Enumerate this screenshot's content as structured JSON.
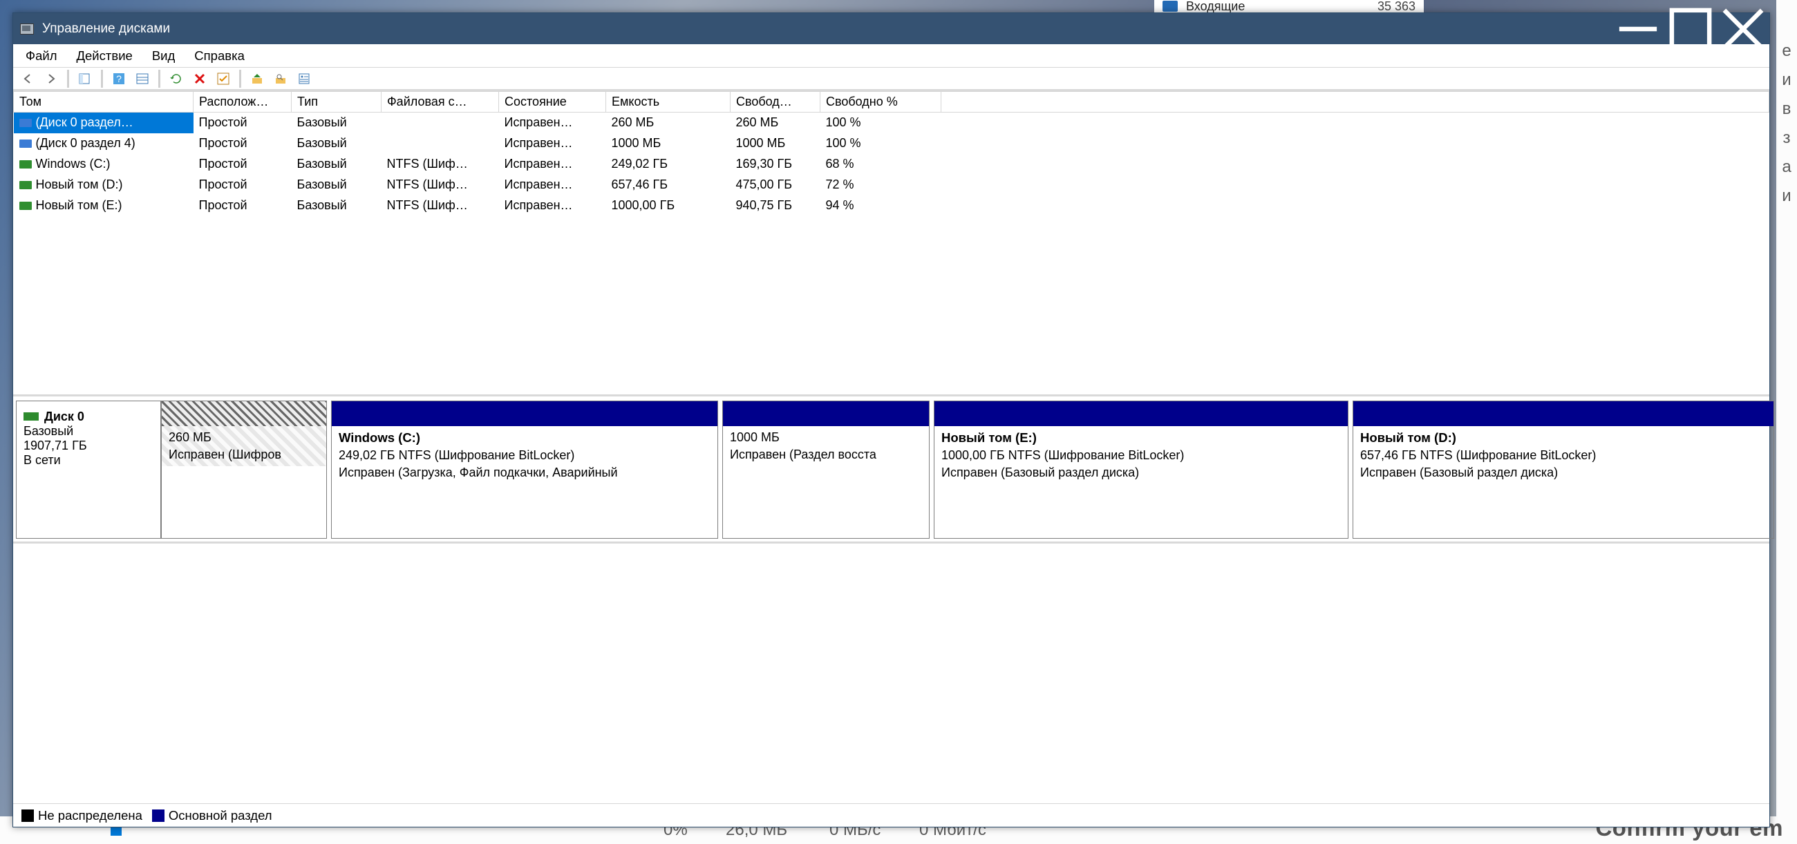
{
  "window": {
    "title": "Управление дисками"
  },
  "menu": {
    "file": "Файл",
    "action": "Действие",
    "view": "Вид",
    "help": "Справка"
  },
  "columns": {
    "volume": "Том",
    "layout": "Располож…",
    "type": "Тип",
    "fs": "Файловая с…",
    "state": "Состояние",
    "capacity": "Емкость",
    "free": "Свобод…",
    "freepct": "Свободно %"
  },
  "rows": [
    {
      "vol": "(Диск 0 раздел…",
      "layout": "Простой",
      "type": "Базовый",
      "fs": "",
      "state": "Исправен…",
      "cap": "260 МБ",
      "free": "260 МБ",
      "pct": "100 %",
      "selected": true
    },
    {
      "vol": "(Диск 0 раздел 4)",
      "layout": "Простой",
      "type": "Базовый",
      "fs": "",
      "state": "Исправен…",
      "cap": "1000 МБ",
      "free": "1000 МБ",
      "pct": "100 %"
    },
    {
      "vol": "Windows (C:)",
      "layout": "Простой",
      "type": "Базовый",
      "fs": "NTFS (Шиф…",
      "state": "Исправен…",
      "cap": "249,02 ГБ",
      "free": "169,30 ГБ",
      "pct": "68 %"
    },
    {
      "vol": "Новый том (D:)",
      "layout": "Простой",
      "type": "Базовый",
      "fs": "NTFS (Шиф…",
      "state": "Исправен…",
      "cap": "657,46 ГБ",
      "free": "475,00 ГБ",
      "pct": "72 %"
    },
    {
      "vol": "Новый том (E:)",
      "layout": "Простой",
      "type": "Базовый",
      "fs": "NTFS (Шиф…",
      "state": "Исправен…",
      "cap": "1000,00 ГБ",
      "free": "940,75 ГБ",
      "pct": "94 %"
    }
  ],
  "disk": {
    "name": "Диск 0",
    "kind": "Базовый",
    "size": "1907,71 ГБ",
    "online": "В сети",
    "parts": [
      {
        "title": "",
        "line1": "260 МБ",
        "line2": "Исправен (Шифров",
        "flex": 240,
        "hatch": true
      },
      {
        "title": "Windows  (C:)",
        "line1": "249,02 ГБ NTFS (Шифрование BitLocker)",
        "line2": "Исправен (Загрузка, Файл подкачки, Аварийный",
        "flex": 560
      },
      {
        "title": "",
        "line1": "1000 МБ",
        "line2": "Исправен (Раздел восста",
        "flex": 300
      },
      {
        "title": "Новый том  (E:)",
        "line1": "1000,00 ГБ NTFS (Шифрование BitLocker)",
        "line2": "Исправен (Базовый раздел диска)",
        "flex": 600
      },
      {
        "title": "Новый том  (D:)",
        "line1": "657,46 ГБ NTFS (Шифрование BitLocker)",
        "line2": "Исправен (Базовый раздел диска)",
        "flex": 610
      }
    ]
  },
  "legend": {
    "unalloc": "Не распределена",
    "primary": "Основной раздел"
  }
}
